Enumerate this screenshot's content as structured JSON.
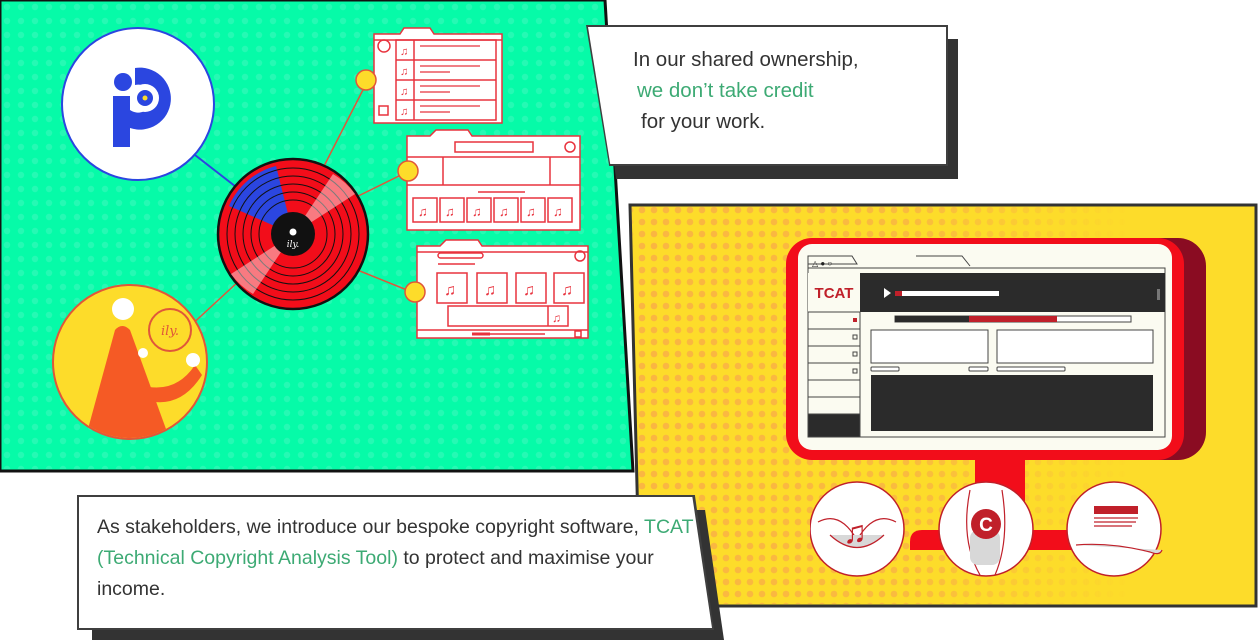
{
  "colors": {
    "green_panel": "#06fba8",
    "yellow_panel": "#fddc2a",
    "red": "#f20d1a",
    "dark_red": "#8a0c22",
    "blue": "#2b46e0",
    "orange": "#f55a25",
    "highlight_text": "#3daa74",
    "body_text": "#333333",
    "shadow": "#333333"
  },
  "top_caption": {
    "line1": "In our shared ownership,",
    "line2_highlight": "we don’t take credit",
    "line3": "for your work."
  },
  "bottom_caption": {
    "part1": "As stakeholders, we introduce our bespoke copyright software,",
    "highlight": "TCAT (Technical Copyright Analysis Tool)",
    "part2": "to protect and maximise your income."
  },
  "left_illustration": {
    "logo_icon": "ip-logo",
    "record_label": "ily.",
    "badge_label": "ily.",
    "windows": [
      {
        "name": "track-list-window",
        "rows": 4
      },
      {
        "name": "album-grid-window",
        "tiles": 6
      },
      {
        "name": "player-window",
        "tiles": 4
      }
    ]
  },
  "tcat_screen": {
    "brand": "TCAT",
    "window_controls": [
      "triangle",
      "dot",
      "circle"
    ],
    "playback_progress": 0.07,
    "analysis_bar": {
      "dark": 0.31,
      "red": 0.37,
      "empty": 0.32
    },
    "sidebar_items": 6,
    "icons": [
      "music-in-hands-icon",
      "copyright-hand-icon",
      "money-in-hand-icon"
    ]
  }
}
